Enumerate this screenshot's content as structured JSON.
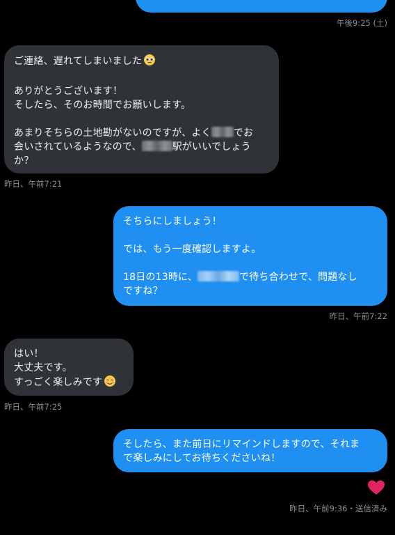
{
  "top_timestamp": "午後9:25 (土)",
  "messages": [
    {
      "direction": "incoming",
      "para1": "ご連絡、遅れてしまいました",
      "para2": "ありがとうございます！\nそしたら、そのお時間でお願いします。",
      "line3a": "あまりそちらの土地勘がないのですが、よく",
      "line3b": "でお",
      "line4a": "会いされているようなので、",
      "line4b": "駅がいいでしょう",
      "line5": "か？",
      "emoji": "pleading-face-emoji",
      "timestamp": "昨日、午前7:21"
    },
    {
      "direction": "outgoing",
      "para1": "そちらにしましょう！",
      "para2": "では、もう一度確認しますよ。",
      "line3a": "18日の13時に、",
      "line3b": "で待ち合わせで、問題なし",
      "line4": "ですね？",
      "timestamp": "昨日、午前7:22"
    },
    {
      "direction": "incoming",
      "text": "はい！\n大丈夫です。\nすっごく楽しみです",
      "emoji": "smiling-blush-emoji",
      "timestamp": "昨日、午前7:25"
    },
    {
      "direction": "outgoing",
      "text": "そしたら、また前日にリマインドしますので、それま\nで楽しみにしてお待ちくださいね！",
      "reaction": "heart-icon",
      "timestamp": "昨日、午前9:36・送信済み"
    }
  ],
  "colors": {
    "background": "#000000",
    "incoming_bubble": "#2f3337",
    "outgoing_bubble": "#1f8ff1",
    "timestamp": "#8b9096",
    "heart": "#e0245e"
  }
}
